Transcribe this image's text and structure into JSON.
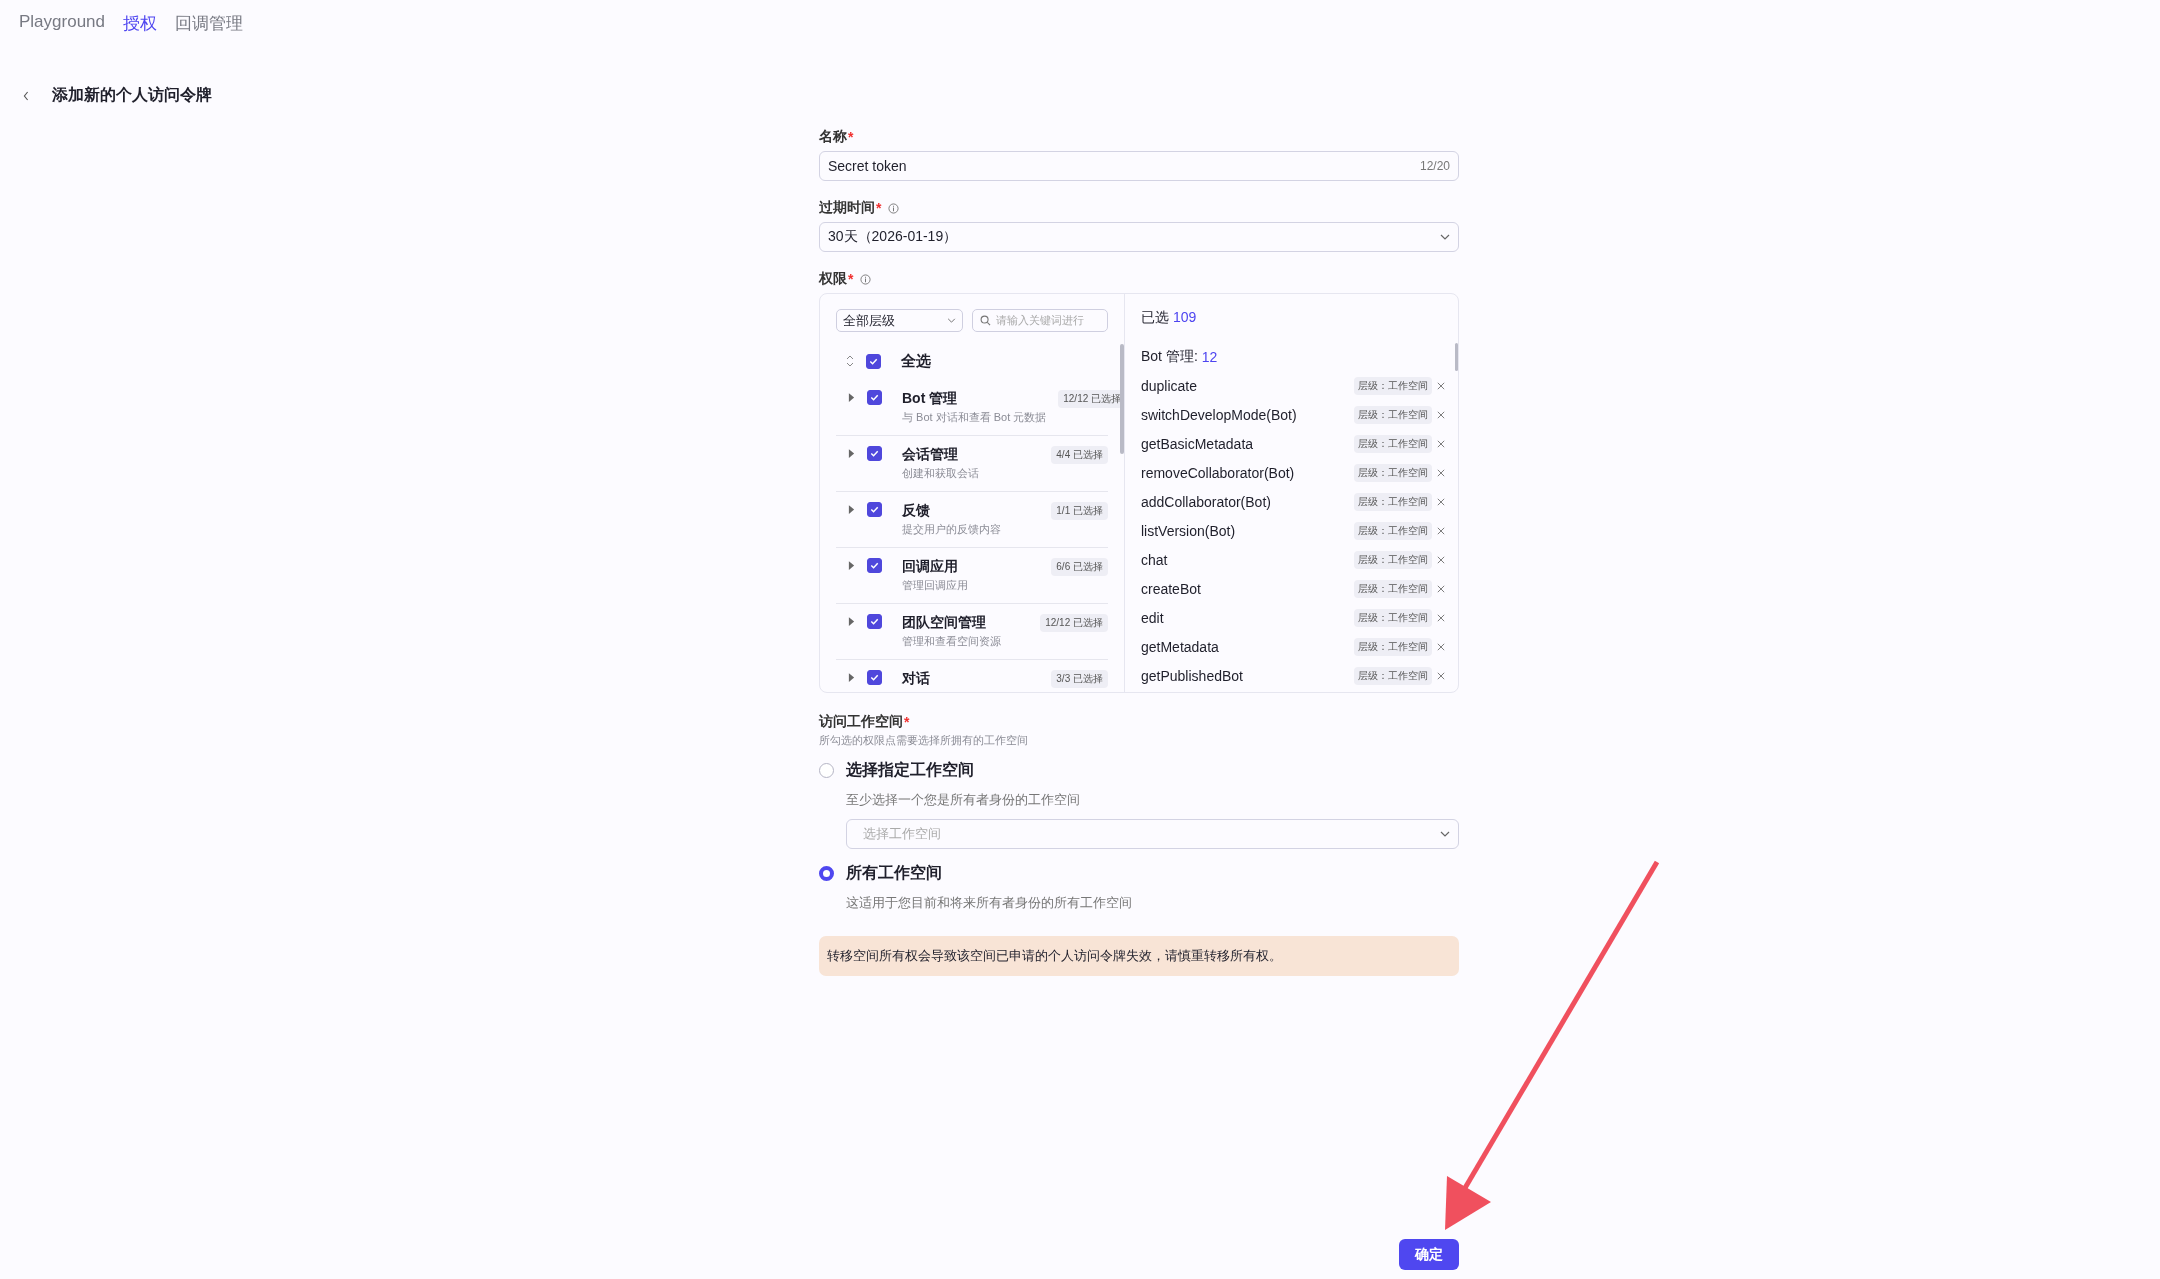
{
  "nav": [
    {
      "label": "Playground",
      "selected": false
    },
    {
      "label": "授权",
      "selected": true
    },
    {
      "label": "回调管理",
      "selected": false
    }
  ],
  "page_title": "添加新的个人访问令牌",
  "name_field": {
    "label": "名称",
    "required_mark": "*",
    "value": "Secret token",
    "counter": "12/20"
  },
  "expiry_field": {
    "label": "过期时间",
    "required_mark": "*",
    "value": "30天（2026-01-19）"
  },
  "permissions": {
    "label": "权限",
    "required_mark": "*",
    "level_select": "全部层级",
    "search_placeholder": "请输入关键词进行",
    "select_all": {
      "label": "全选",
      "checked": true
    },
    "groups": [
      {
        "name": "Bot 管理",
        "description": "与 Bot 对话和查看 Bot 元数据",
        "count": "12/12 已选择",
        "checked": true,
        "expanded": false
      },
      {
        "name": "会话管理",
        "description": "创建和获取会话",
        "count": "4/4 已选择",
        "checked": true,
        "expanded": false
      },
      {
        "name": "反馈",
        "description": "提交用户的反馈内容",
        "count": "1/1 已选择",
        "checked": true,
        "expanded": false
      },
      {
        "name": "回调应用",
        "description": "管理回调应用",
        "count": "6/6 已选择",
        "checked": true,
        "expanded": false
      },
      {
        "name": "团队空间管理",
        "description": "管理和查看空间资源",
        "count": "12/12 已选择",
        "checked": true,
        "expanded": false
      },
      {
        "name": "对话",
        "count": "3/3 已选择",
        "checked": true,
        "expanded": false
      }
    ],
    "selected_label": "已选",
    "selected_count": "109",
    "section": {
      "label": "Bot 管理:",
      "count": "12"
    },
    "items": [
      {
        "name": "duplicate",
        "tag": "层级：工作空间"
      },
      {
        "name": "switchDevelopMode(Bot)",
        "tag": "层级：工作空间"
      },
      {
        "name": "getBasicMetadata",
        "tag": "层级：工作空间"
      },
      {
        "name": "removeCollaborator(Bot)",
        "tag": "层级：工作空间"
      },
      {
        "name": "addCollaborator(Bot)",
        "tag": "层级：工作空间"
      },
      {
        "name": "listVersion(Bot)",
        "tag": "层级：工作空间"
      },
      {
        "name": "chat",
        "tag": "层级：工作空间"
      },
      {
        "name": "createBot",
        "tag": "层级：工作空间"
      },
      {
        "name": "edit",
        "tag": "层级：工作空间"
      },
      {
        "name": "getMetadata",
        "tag": "层级：工作空间"
      },
      {
        "name": "getPublishedBot",
        "tag": "层级：工作空间"
      }
    ]
  },
  "workspace": {
    "label": "访问工作空间",
    "required_mark": "*",
    "hint": "所勾选的权限点需要选择所拥有的工作空间",
    "options": [
      {
        "label": "选择指定工作空间",
        "description": "至少选择一个您是所有者身份的工作空间",
        "selected": false,
        "select_placeholder": "选择工作空间"
      },
      {
        "label": "所有工作空间",
        "description": "这适用于您目前和将来所有者身份的所有工作空间",
        "selected": true
      }
    ]
  },
  "warning": "转移空间所有权会导致该空间已申请的个人访问令牌失效，请慎重转移所有权。",
  "submit": "确定"
}
